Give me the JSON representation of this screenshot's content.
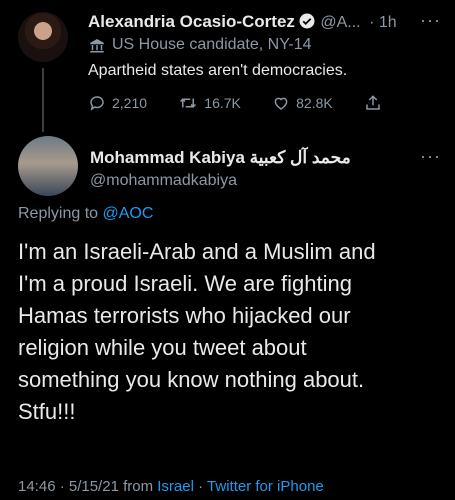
{
  "parent_tweet": {
    "author_name": "Alexandria Ocasio-Cortez",
    "author_handle": "@A...",
    "time": "· 1h",
    "label": "US House candidate, NY-14",
    "text": "Apartheid states aren't democracies.",
    "replies": "2,210",
    "retweets": "16.7K",
    "likes": "82.8K"
  },
  "reply_tweet": {
    "author_name": "Mohammad Kabiya محمد آل كعبية",
    "author_handle": "@mohammadkabiya",
    "replying_prefix": "Replying to",
    "replying_to": "@AOC",
    "text_lines": [
      "I'm an Israeli-Arab and a Muslim and",
      "I'm a proud Israeli. We are fighting",
      "Hamas terrorists who hijacked our",
      "religion while you tweet about",
      "something you know nothing about.",
      "Stfu!!!"
    ],
    "timestamp": "14:46 · 5/15/21 from",
    "location": "Israel",
    "separator": "·",
    "source": "Twitter for iPhone"
  },
  "more_label": "···",
  "colors": {
    "link": "#1d9bf0",
    "muted": "#8b98a5",
    "background": "#000000"
  }
}
